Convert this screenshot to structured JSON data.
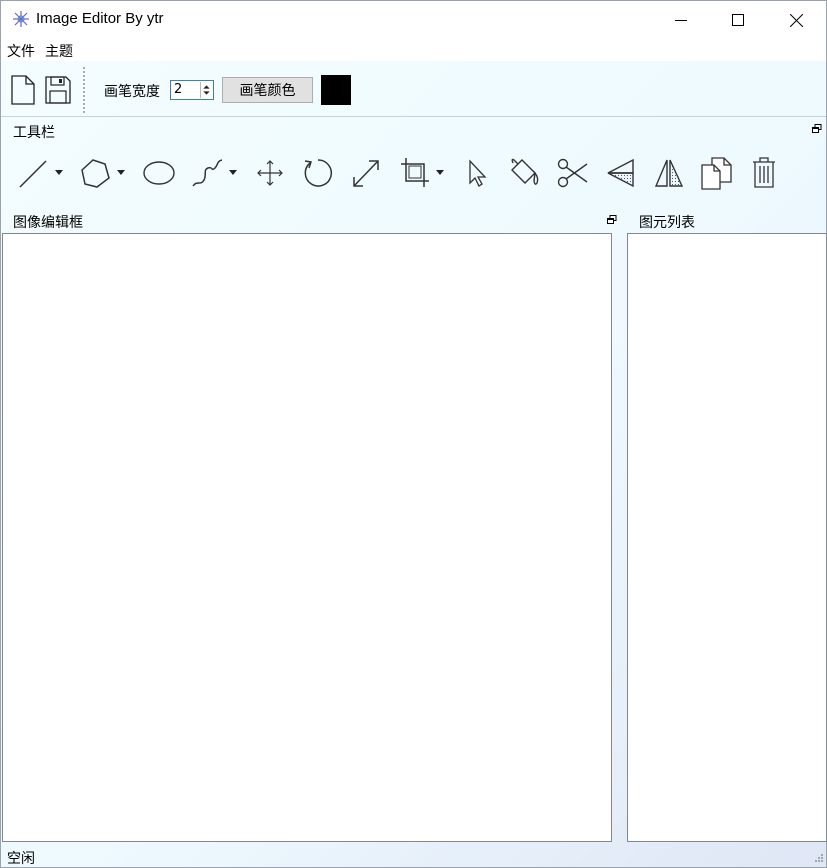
{
  "window": {
    "title": "Image Editor By ytr"
  },
  "menubar": {
    "items": [
      "文件",
      "主题"
    ]
  },
  "toolbar": {
    "pen_width_label": "画笔宽度",
    "pen_width_value": "2",
    "pen_color_button": "画笔颜色",
    "pen_color": "#000000"
  },
  "tools_panel": {
    "title": "工具栏",
    "tools": [
      "line-tool",
      "polygon-tool",
      "ellipse-tool",
      "curve-tool",
      "move-tool",
      "rotate-tool",
      "scale-tool",
      "crop-tool",
      "select-tool",
      "fill-tool",
      "cut-tool",
      "flip-horizontal-tool",
      "flip-vertical-tool",
      "copy-tool",
      "delete-tool"
    ]
  },
  "editor_panel": {
    "title": "图像编辑框"
  },
  "list_panel": {
    "title": "图元列表"
  },
  "status": {
    "text": "空闲"
  }
}
